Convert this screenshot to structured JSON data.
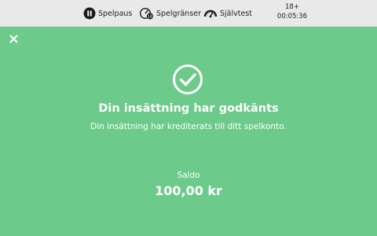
{
  "topbar": {
    "pause_label": "Spelpaus",
    "limits_label": "Spelgränser",
    "selftest_label": "Självtest",
    "age_badge": "18+",
    "session_time": "00:05:36"
  },
  "dialog": {
    "title": "Din insättning har godkänts",
    "message": "Din insättning har krediterats till ditt spelkonto.",
    "balance_label": "Saldo",
    "balance_value": "100,00 kr"
  },
  "icons": {
    "close": "close-icon",
    "success": "checkmark-circle-icon",
    "pause": "pause-icon",
    "limits": "limits-icon",
    "selftest": "gauge-icon"
  },
  "colors": {
    "background": "#6cca8a",
    "topbar": "#e9e9e9",
    "text": "#ffffff"
  }
}
